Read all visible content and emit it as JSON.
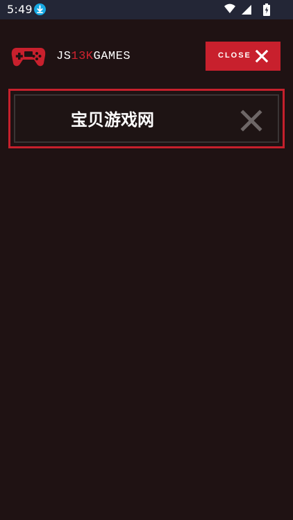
{
  "status_bar": {
    "time": "5:49",
    "icons": [
      "download-icon",
      "wifi-icon",
      "signal-icon",
      "battery-icon"
    ]
  },
  "header": {
    "logo": {
      "icon": "gamepad-icon",
      "text_parts": [
        "JS",
        "13K",
        "GAMES"
      ]
    },
    "close_button": {
      "label": "CLOSE",
      "icon": "close-icon"
    }
  },
  "game_panel": {
    "title": "宝贝游戏网",
    "icon": "dismiss-icon"
  },
  "colors": {
    "background": "#1f1213",
    "status_bar": "#232636",
    "accent_red": "#c8202d",
    "panel_border": "#c6202c",
    "muted_x": "#6e6767"
  }
}
